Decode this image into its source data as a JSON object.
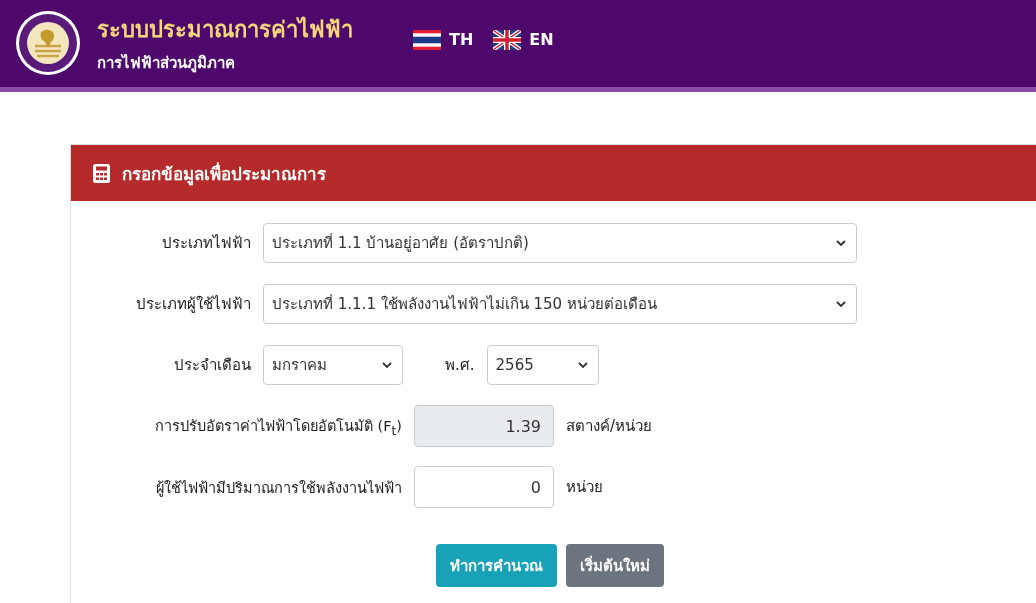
{
  "header": {
    "title": "ระบบประมาณการค่าไฟฟ้า",
    "subtitle": "การไฟฟ้าส่วนภูมิภาค",
    "languages": [
      {
        "code": "TH",
        "kind": "thai"
      },
      {
        "code": "EN",
        "kind": "uk"
      }
    ]
  },
  "card": {
    "title": "กรอกข้อมูลเพื่อประมาณการ",
    "fields": [
      {
        "kind": "select",
        "label": "ประเภทไฟฟ้า",
        "value": "ประเภทที่ 1.1 บ้านอยู่อาศัย (อัตราปกติ)"
      },
      {
        "kind": "select",
        "label": "ประเภทผู้ใช้ไฟฟ้า",
        "value": "ประเภทที่ 1.1.1 ใช้พลังงานไฟฟ้าไม่เกิน 150 หน่วยต่อเดือน"
      },
      {
        "kind": "month-year",
        "label": "ประจำเดือน",
        "value": "มกราคม",
        "year_label": "พ.ศ.",
        "year": "2565"
      },
      {
        "kind": "number",
        "label": "การปรับอัตราค่าไฟฟ้าโดยอัตโนมัติ (F$_{t}$)",
        "value": "1.39",
        "unit": "สตางค์/หน่วย",
        "disabled": true
      },
      {
        "kind": "number",
        "label": "ผู้ใช้ไฟฟ้ามีปริมาณการใช้พลังงานไฟฟ้า",
        "value": "0",
        "unit": "หน่วย",
        "disabled": false
      }
    ],
    "buttons": [
      {
        "label": "ทำการคำนวณ",
        "kind": "primary"
      },
      {
        "label": "เริ่มต้นใหม่",
        "kind": "secondary"
      }
    ]
  }
}
